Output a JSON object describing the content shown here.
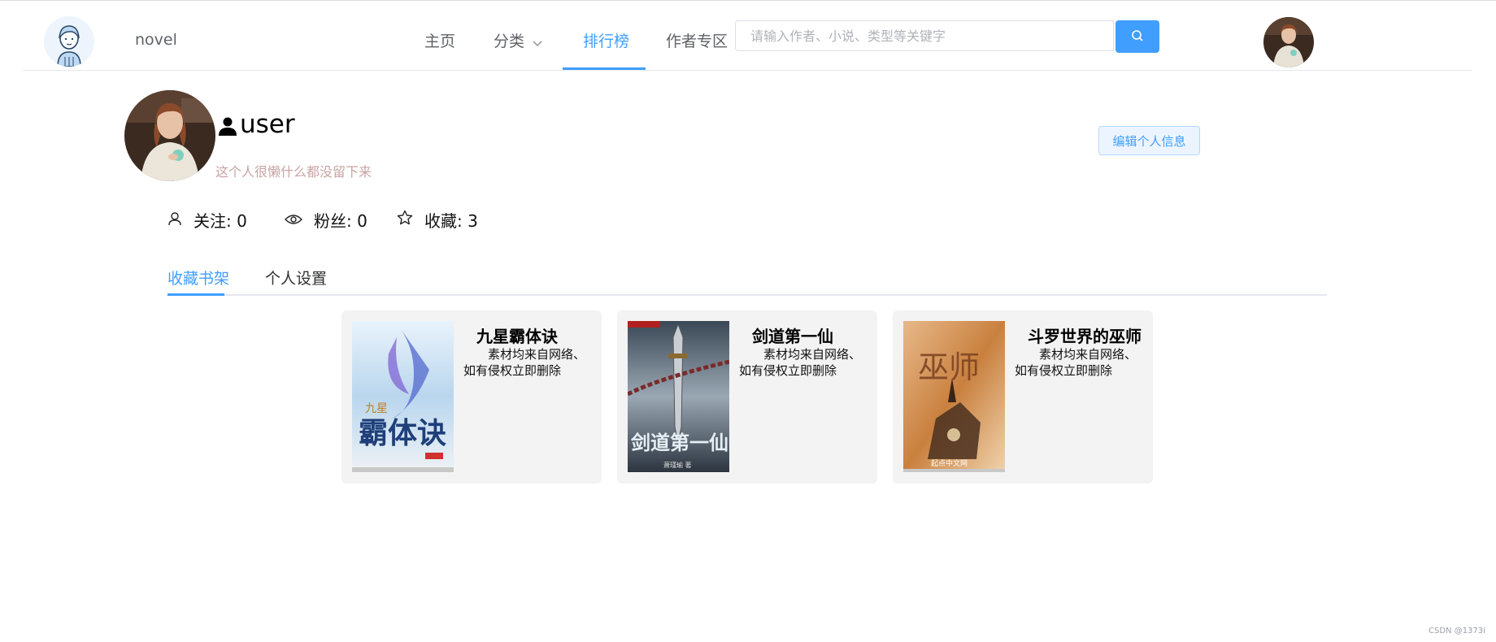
{
  "header": {
    "brand": "novel",
    "nav": {
      "home": "主页",
      "category": "分类",
      "ranking": "排行榜",
      "author_zone": "作者专区"
    },
    "search": {
      "placeholder": "请输入作者、小说、类型等关键字",
      "value": ""
    }
  },
  "profile": {
    "username": "user",
    "bio": "这个人很懒什么都没留下来",
    "edit_label": "编辑个人信息",
    "stats": {
      "following": "关注: 0",
      "followers": "粉丝: 0",
      "favorites": "收藏: 3"
    }
  },
  "tabs": [
    {
      "label": "收藏书架",
      "active": true
    },
    {
      "label": "个人设置",
      "active": false
    }
  ],
  "books": [
    {
      "title": "九星霸体诀",
      "desc": "素材均来自网络、如有侵权立即删除",
      "cover_text": "霸体诀",
      "cover_small": "九星"
    },
    {
      "title": "剑道第一仙",
      "desc": "素材均来自网络、如有侵权立即删除",
      "cover_text": "剑道第一仙",
      "cover_small": "萧瑾瑜 著"
    },
    {
      "title": "斗罗世界的巫师",
      "desc": "素材均来自网络、如有侵权立即删除",
      "cover_text": "巫师",
      "cover_small": "起点中文网"
    }
  ],
  "watermark": "CSDN @1373i",
  "colors": {
    "accent": "#409eff",
    "card_bg": "#f3f3f3",
    "bio": "#c8a3a3"
  }
}
